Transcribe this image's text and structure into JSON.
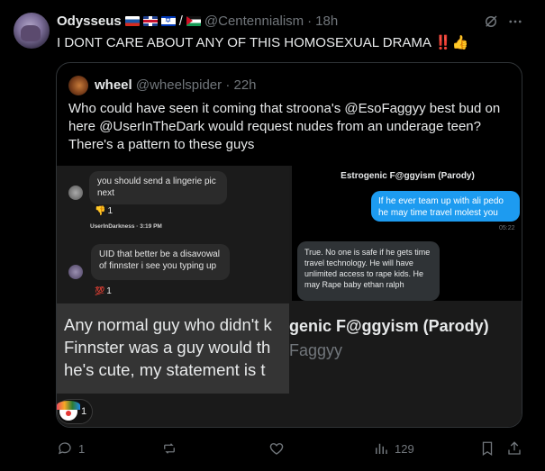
{
  "author": {
    "display_name": "Odysseus",
    "flags": [
      "ru-flag",
      "uk-flag",
      "il-flag",
      "ps-flag"
    ],
    "flag_separator": "/",
    "handle": "@Centennialism",
    "time": "18h"
  },
  "tweet_text": "I DONT CARE ABOUT ANY OF THIS HOMOSEXUAL DRAMA",
  "tweet_emoji": "‼️👍",
  "quote": {
    "display_name": "wheel",
    "handle": "@wheelspider",
    "time": "22h",
    "text": "Who could have seen it coming that stroona's @EsoFaggyy best bud on here @UserInTheDark would request nudes from an underage teen? There's a pattern to these guys",
    "media": {
      "left_chat": {
        "msg1": "you should send a lingerie pic next",
        "msg1_reaction": "👎",
        "msg1_reaction_count": "1",
        "msg1_sender": "UserInDarkness · 3:19 PM",
        "msg2": "UID that better be a disavowal of finnster i see you typing up",
        "msg2_reaction": "💯",
        "msg2_reaction_count": "1"
      },
      "right_chat": {
        "title": "Estrogenic F@ggyism (Parody)",
        "blue_msg": "If he ever team up with ali pedo he may time travel molest you",
        "blue_time": "05:22",
        "grey_msg": "True. No one is safe if he gets time travel technology. He will have unlimited access to rape kids. He may Rape baby ethan ralph"
      },
      "zoom_text": [
        "Any normal guy who didn't k",
        "Finnster was a guy would th",
        "he's cute, my statement is t"
      ],
      "zoom_title": "genic F@ggyism (Parody)",
      "zoom_sub": "Faggyy",
      "reaction_emoji": "clown-icon",
      "reaction_count": "1"
    }
  },
  "actions": {
    "replies": "1",
    "reposts": "",
    "likes": "",
    "views": "129"
  }
}
